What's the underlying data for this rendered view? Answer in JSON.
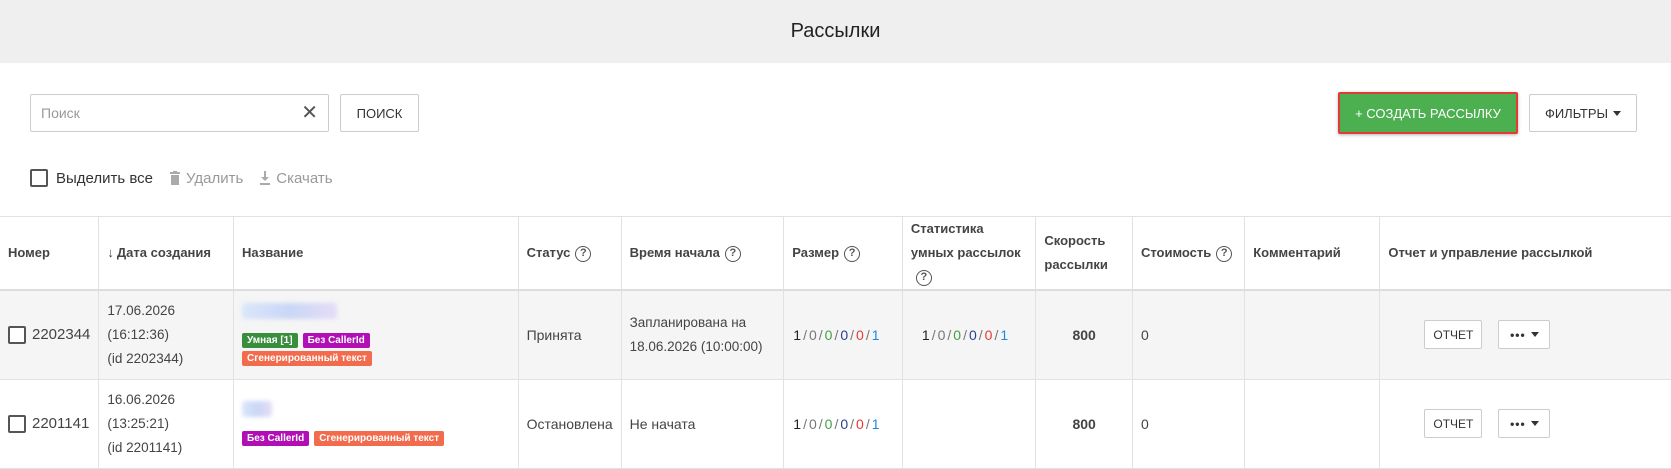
{
  "page_title": "Рассылки",
  "search": {
    "placeholder": "Поиск",
    "clear_icon": "close-icon",
    "button_label": "ПОИСК"
  },
  "actions": {
    "create_label": "+ СОЗДАТЬ РАССЫЛКУ",
    "filters_label": "ФИЛЬТРЫ"
  },
  "colors": {
    "create_bg": "#4caf50",
    "create_border": "#e53935",
    "tag_smart": "#388e3c",
    "tag_callerid": "#b10fb5",
    "tag_generated": "#f26b4d"
  },
  "bulk": {
    "select_all": "Выделить все",
    "delete": "Удалить",
    "download": "Скачать"
  },
  "columns": {
    "number": "Номер",
    "created": "Дата создания",
    "name": "Название",
    "status": "Статус",
    "start_time": "Время начала",
    "size": "Размер",
    "smart_stats": "Статистика умных рассылок",
    "speed": "Скорость рассылки",
    "cost": "Стоимость",
    "comment": "Комментарий",
    "report": "Отчет и управление рассылкой"
  },
  "rows": [
    {
      "number": "2202344",
      "date": "17.06.2026",
      "time": "(16:12:36)",
      "id": "(id 2202344)",
      "tags": {
        "smart": "Умная [1]",
        "callerid": "Без CallerId",
        "generated": "Сгенерированный текст"
      },
      "status": "Принята",
      "start_line1": "Запланирована на",
      "start_line2": "18.06.2026 (10:00:00)",
      "size": [
        "1",
        "0",
        "0",
        "0",
        "0",
        "1"
      ],
      "smart_stats": [
        "1",
        "0",
        "0",
        "0",
        "0",
        "1"
      ],
      "speed": "800",
      "cost": "0",
      "comment": "",
      "report_label": "ОТЧЕТ",
      "more_label": "•••"
    },
    {
      "number": "2201141",
      "date": "16.06.2026",
      "time": "(13:25:21)",
      "id": "(id 2201141)",
      "tags": {
        "callerid": "Без CallerId",
        "generated": "Сгенерированный текст"
      },
      "status": "Остановлена",
      "start_line1": "Не начата",
      "size": [
        "1",
        "0",
        "0",
        "0",
        "0",
        "1"
      ],
      "speed": "800",
      "cost": "0",
      "comment": "",
      "report_label": "ОТЧЕТ",
      "more_label": "•••"
    }
  ]
}
